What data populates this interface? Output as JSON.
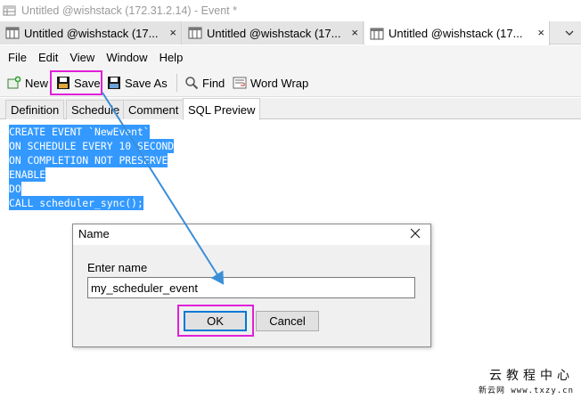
{
  "window": {
    "title": "Untitled @wishstack (172.31.2.14) - Event *"
  },
  "doc_tabs": [
    {
      "label": "Untitled @wishstack (17...",
      "close": "×"
    },
    {
      "label": "Untitled @wishstack (17...",
      "close": "×"
    },
    {
      "label": "Untitled @wishstack (17...",
      "close": "×"
    }
  ],
  "menu": [
    "File",
    "Edit",
    "View",
    "Window",
    "Help"
  ],
  "toolbar": {
    "new_label": "New",
    "save_label": "Save",
    "save_as_label": "Save As",
    "find_label": "Find",
    "word_wrap_label": "Word Wrap"
  },
  "sub_tabs": [
    "Definition",
    "Schedule",
    "Comment",
    "SQL Preview"
  ],
  "sql_lines": [
    "CREATE EVENT `NewEvent`",
    "ON SCHEDULE EVERY 10 SECOND",
    "ON COMPLETION NOT PRESERVE",
    "ENABLE",
    "DO",
    "CALL scheduler_sync();"
  ],
  "dialog": {
    "title": "Name",
    "close": "×",
    "label": "Enter name",
    "input_value": "my_scheduler_event",
    "ok_label": "OK",
    "cancel_label": "Cancel"
  },
  "watermark": {
    "line1": "云教程中心",
    "line2": "新云网 www.txzy.cn"
  },
  "colors": {
    "selection": "#3399ff",
    "highlight": "#e020d8",
    "arrow": "#3a8fd8",
    "focus": "#0078d7"
  }
}
